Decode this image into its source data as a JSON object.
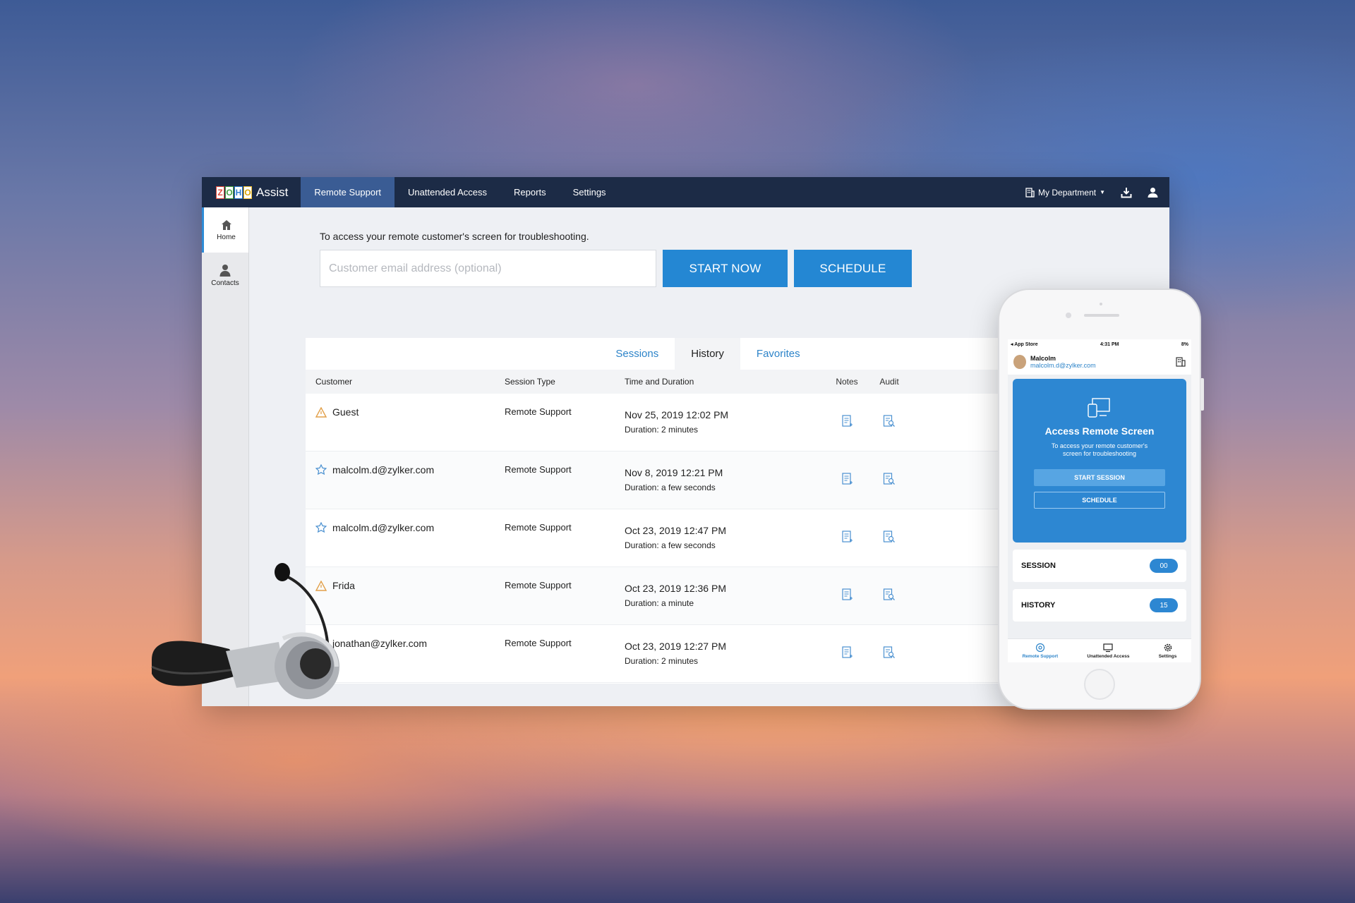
{
  "app": {
    "logo_letters": [
      "Z",
      "O",
      "H",
      "O"
    ],
    "logo_colors": [
      "#e24a3b",
      "#47a447",
      "#2f7fd3",
      "#f1c232"
    ],
    "logo_text": "Assist",
    "nav": [
      "Remote Support",
      "Unattended Access",
      "Reports",
      "Settings"
    ],
    "active_nav": "Remote Support",
    "department": "My Department",
    "icons": [
      "building-icon",
      "download-icon",
      "user-icon"
    ]
  },
  "sidebar": {
    "items": [
      {
        "label": "Home",
        "icon": "home-icon",
        "active": true
      },
      {
        "label": "Contacts",
        "icon": "contact-icon",
        "active": false
      }
    ]
  },
  "start": {
    "intro": "To access your remote customer's screen for troubleshooting.",
    "email_placeholder": "Customer email address (optional)",
    "start_label": "START NOW",
    "schedule_label": "SCHEDULE"
  },
  "tabs": {
    "items": [
      "Sessions",
      "History",
      "Favorites"
    ],
    "active": "History"
  },
  "table": {
    "columns": [
      "Customer",
      "Session Type",
      "Time and Duration",
      "Notes",
      "Audit"
    ],
    "rows": [
      {
        "customer": "Guest",
        "icon": "warning-icon",
        "type": "Remote Support",
        "time": "Nov 25, 2019 12:02 PM",
        "duration": "Duration: 2 minutes"
      },
      {
        "customer": "malcolm.d@zylker.com",
        "icon": "star-icon",
        "type": "Remote Support",
        "time": "Nov 8, 2019 12:21 PM",
        "duration": "Duration: a few seconds"
      },
      {
        "customer": "malcolm.d@zylker.com",
        "icon": "star-icon",
        "type": "Remote Support",
        "time": "Oct 23, 2019 12:47 PM",
        "duration": "Duration: a few seconds"
      },
      {
        "customer": "Frida",
        "icon": "warning-icon",
        "type": "Remote Support",
        "time": "Oct 23, 2019 12:36 PM",
        "duration": "Duration: a minute"
      },
      {
        "customer": "jonathan@zylker.com",
        "icon": "star-icon",
        "type": "Remote Support",
        "time": "Oct 23, 2019 12:27 PM",
        "duration": "Duration: 2 minutes"
      }
    ]
  },
  "phone": {
    "status": {
      "left": "◂ App Store",
      "time": "4:31 PM",
      "right": "8%"
    },
    "user_name": "Malcolm",
    "user_email": "malcolm.d@zylker.com",
    "card_title": "Access Remote Screen",
    "card_subtitle": "To access your remote customer's screen for troubleshooting",
    "start_session": "START SESSION",
    "schedule": "SCHEDULE",
    "session_label": "SESSION",
    "session_count": "00",
    "history_label": "HISTORY",
    "history_count": "15",
    "tabs": [
      "Remote Support",
      "Unattended Access",
      "Settings"
    ],
    "accent": "#2d87d2"
  }
}
